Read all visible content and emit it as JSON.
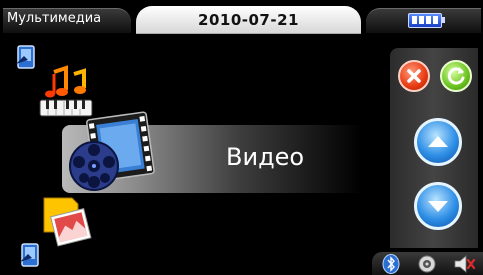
{
  "header": {
    "app_title": "Мультимедиа",
    "date": "2010-07-21",
    "battery_icon": "battery-icon"
  },
  "main": {
    "current_item_label": "Видео",
    "items": [
      {
        "icon": "music-icon"
      },
      {
        "icon": "video-icon"
      },
      {
        "icon": "photo-icon"
      }
    ]
  },
  "side_panel": {
    "close_icon": "close-icon",
    "refresh_icon": "refresh-icon",
    "up_icon": "arrow-up-icon",
    "down_icon": "arrow-down-icon"
  },
  "bottom_icons": [
    "bluetooth-icon",
    "speaker-icon",
    "volume-icon"
  ],
  "colors": {
    "accent_blue": "#2f8fe6",
    "close_red": "#e63b12",
    "refresh_green": "#6ac21e"
  }
}
